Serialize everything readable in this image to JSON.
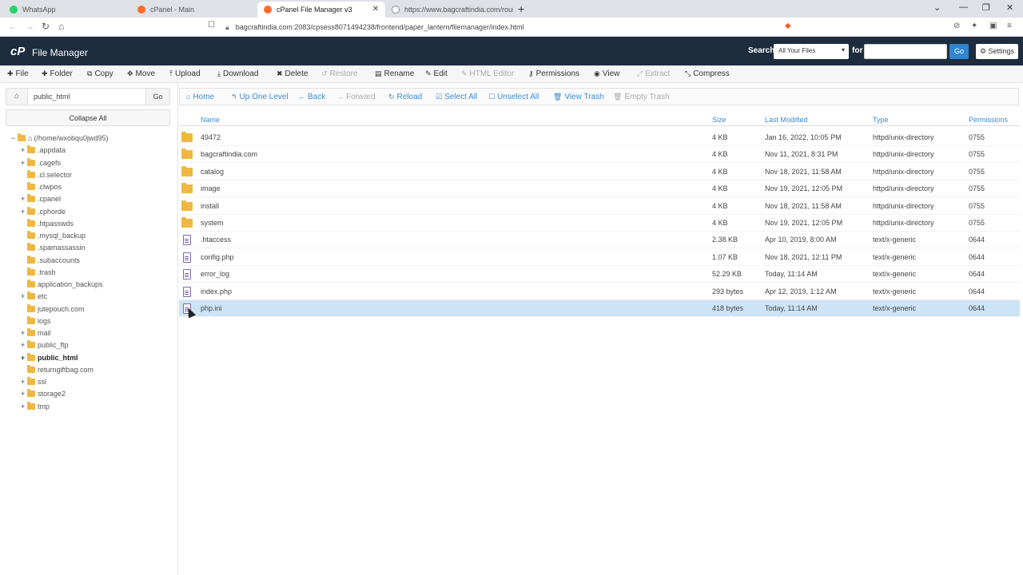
{
  "browser": {
    "tabs": [
      {
        "label": "WhatsApp",
        "icon": "whatsapp-icon",
        "color": "#25d366"
      },
      {
        "label": "cPanel - Main",
        "icon": "cpanel-icon",
        "color": "#ff6c2c"
      },
      {
        "label": "cPanel File Manager v3",
        "icon": "cpanel-icon",
        "color": "#ff6c2c"
      },
      {
        "label": "https://www.bagcraftindia.com/round",
        "icon": "globe-icon",
        "color": "#888888"
      }
    ],
    "url": "bagcraftindia.com:2083/cpsess8071494238/frontend/paper_lantern/filemanager/index.html"
  },
  "header": {
    "logo": "cP",
    "title": "File Manager",
    "search_label": "Search",
    "search_scope": "All Your Files",
    "for_label": "for",
    "search_value": "",
    "go_label": "Go",
    "settings_label": "Settings"
  },
  "toolbar": {
    "file": "File",
    "folder": "Folder",
    "copy": "Copy",
    "move": "Move",
    "upload": "Upload",
    "download": "Download",
    "delete": "Delete",
    "restore": "Restore",
    "rename": "Rename",
    "edit": "Edit",
    "html_editor": "HTML Editor",
    "permissions": "Permissions",
    "view": "View",
    "extract": "Extract",
    "compress": "Compress"
  },
  "sidebar": {
    "path_value": "public_html",
    "go_label": "Go",
    "collapse_label": "Collapse All",
    "root": "(/home/wxobqu0jwd95)",
    "items": [
      {
        "label": ".appdata",
        "expand": "+"
      },
      {
        "label": ".cagefs",
        "expand": "+"
      },
      {
        "label": ".cl.selector",
        "expand": ""
      },
      {
        "label": ".clwpos",
        "expand": ""
      },
      {
        "label": ".cpanel",
        "expand": "+"
      },
      {
        "label": ".cphorde",
        "expand": "+"
      },
      {
        "label": ".htpasswds",
        "expand": ""
      },
      {
        "label": ".mysql_backup",
        "expand": ""
      },
      {
        "label": ".spamassassin",
        "expand": ""
      },
      {
        "label": ".subaccounts",
        "expand": ""
      },
      {
        "label": ".trash",
        "expand": ""
      },
      {
        "label": "application_backups",
        "expand": ""
      },
      {
        "label": "etc",
        "expand": "+"
      },
      {
        "label": "jutepouch.com",
        "expand": ""
      },
      {
        "label": "logs",
        "expand": ""
      },
      {
        "label": "mail",
        "expand": "+"
      },
      {
        "label": "public_ftp",
        "expand": "+"
      },
      {
        "label": "public_html",
        "expand": "+"
      },
      {
        "label": "returngiftbag.com",
        "expand": ""
      },
      {
        "label": "ssl",
        "expand": "+"
      },
      {
        "label": "storage2",
        "expand": "+"
      },
      {
        "label": "tmp",
        "expand": "+"
      }
    ]
  },
  "navbar": {
    "home": "Home",
    "up": "Up One Level",
    "back": "Back",
    "forward": "Forward",
    "reload": "Reload",
    "select_all": "Select All",
    "unselect_all": "Unselect All",
    "view_trash": "View Trash",
    "empty_trash": "Empty Trash"
  },
  "table": {
    "headers": {
      "name": "Name",
      "size": "Size",
      "modified": "Last Modified",
      "type": "Type",
      "perms": "Permissions"
    },
    "rows": [
      {
        "name": "49472",
        "size": "4 KB",
        "modified": "Jan 16, 2022, 10:05 PM",
        "type": "httpd/unix-directory",
        "perms": "0755",
        "kind": "folder"
      },
      {
        "name": "bagcraftindia.com",
        "size": "4 KB",
        "modified": "Nov 11, 2021, 8:31 PM",
        "type": "httpd/unix-directory",
        "perms": "0755",
        "kind": "folder"
      },
      {
        "name": "catalog",
        "size": "4 KB",
        "modified": "Nov 18, 2021, 11:58 AM",
        "type": "httpd/unix-directory",
        "perms": "0755",
        "kind": "folder"
      },
      {
        "name": "image",
        "size": "4 KB",
        "modified": "Nov 19, 2021, 12:05 PM",
        "type": "httpd/unix-directory",
        "perms": "0755",
        "kind": "folder"
      },
      {
        "name": "install",
        "size": "4 KB",
        "modified": "Nov 18, 2021, 11:58 AM",
        "type": "httpd/unix-directory",
        "perms": "0755",
        "kind": "folder"
      },
      {
        "name": "system",
        "size": "4 KB",
        "modified": "Nov 19, 2021, 12:05 PM",
        "type": "httpd/unix-directory",
        "perms": "0755",
        "kind": "folder"
      },
      {
        "name": ".htaccess",
        "size": "2.38 KB",
        "modified": "Apr 10, 2019, 8:00 AM",
        "type": "text/x-generic",
        "perms": "0644",
        "kind": "file"
      },
      {
        "name": "config.php",
        "size": "1.07 KB",
        "modified": "Nov 18, 2021, 12:11 PM",
        "type": "text/x-generic",
        "perms": "0644",
        "kind": "file"
      },
      {
        "name": "error_log",
        "size": "52.29 KB",
        "modified": "Today, 11:14 AM",
        "type": "text/x-generic",
        "perms": "0644",
        "kind": "file"
      },
      {
        "name": "index.php",
        "size": "293 bytes",
        "modified": "Apr 12, 2019, 1:12 AM",
        "type": "text/x-generic",
        "perms": "0644",
        "kind": "file"
      },
      {
        "name": "php.ini",
        "size": "418 bytes",
        "modified": "Today, 11:14 AM",
        "type": "text/x-generic",
        "perms": "0644",
        "kind": "file",
        "selected": true
      }
    ]
  },
  "colors": {
    "header_bg": "#1d2d3f",
    "accent": "#2f86cf",
    "folder": "#f0b742",
    "selected_row": "#cde3f6"
  }
}
